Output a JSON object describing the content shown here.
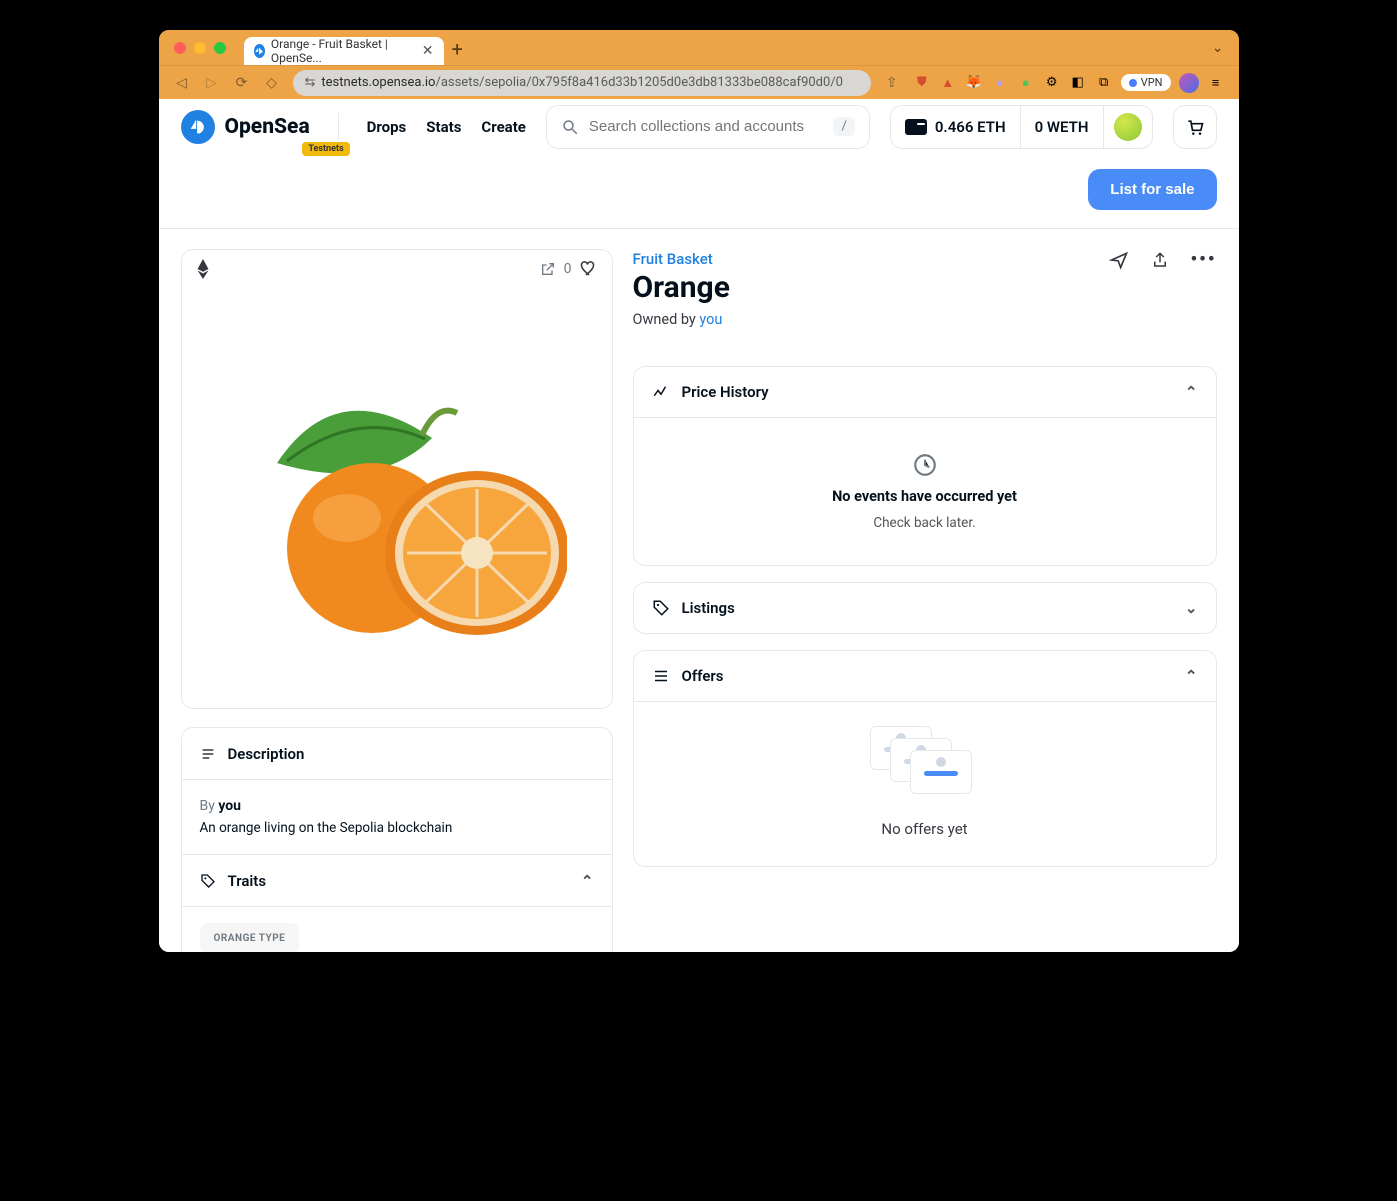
{
  "browser": {
    "tab_title": "Orange - Fruit Basket | OpenSe...",
    "url_host": "testnets.opensea.io",
    "url_path": "/assets/sepolia/0x795f8a416d33b1205d0e3db81333be088caf90d0/0",
    "vpn_label": "VPN"
  },
  "nav": {
    "brand": "OpenSea",
    "testnets_badge": "Testnets",
    "links": {
      "drops": "Drops",
      "stats": "Stats",
      "create": "Create"
    },
    "search_placeholder": "Search collections and accounts",
    "search_kbd": "/",
    "eth_balance": "0.466 ETH",
    "weth_balance": "0 WETH"
  },
  "actions": {
    "list_for_sale": "List for sale"
  },
  "asset": {
    "collection": "Fruit Basket",
    "name": "Orange",
    "owned_prefix": "Owned by ",
    "owned_by": "you",
    "like_count": "0"
  },
  "description_panel": {
    "title": "Description",
    "by_prefix": "By ",
    "by_value": "you",
    "text": "An orange living on the Sepolia blockchain"
  },
  "traits_panel": {
    "title": "Traits",
    "trait1_label": "ORANGE TYPE"
  },
  "price_history": {
    "title": "Price History",
    "no_events": "No events have occurred yet",
    "check_back": "Check back later."
  },
  "listings": {
    "title": "Listings"
  },
  "offers": {
    "title": "Offers",
    "empty": "No offers yet"
  }
}
